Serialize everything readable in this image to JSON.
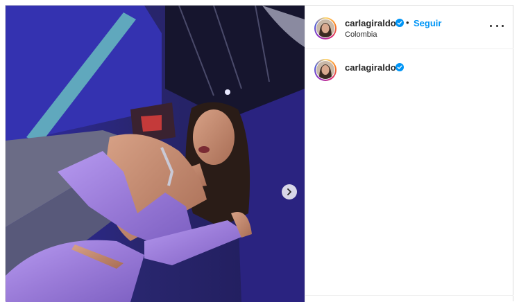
{
  "post": {
    "username": "carlagiraldo",
    "location": "Colombia",
    "follow_label": "Seguir",
    "separator": "•",
    "caption_username": "carlagiraldo"
  },
  "icons": {
    "verified": "verified-badge-icon",
    "more": "more-options-icon",
    "next": "chevron-right-icon"
  },
  "colors": {
    "follow": "#0095f6",
    "verified": "#0095f6",
    "text": "#262626",
    "dress": "#a98ae0",
    "backdrop": "#2a2470"
  }
}
